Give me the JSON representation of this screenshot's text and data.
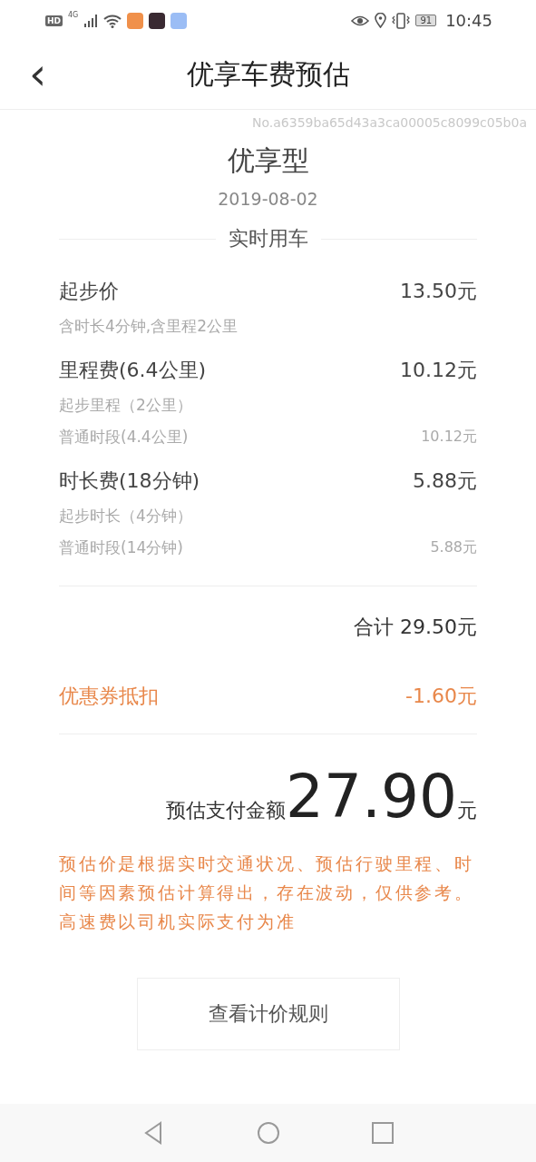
{
  "status_bar": {
    "hd": "HD",
    "network": "4G",
    "battery": "91",
    "time": "10:45"
  },
  "header": {
    "back": "‹",
    "title": "优享车费预估"
  },
  "order_no": "No.a6359ba65d43a3ca00005c8099c05b0a",
  "car_type": "优享型",
  "date": "2019-08-02",
  "section": "实时用车",
  "fees": [
    {
      "name": "起步价",
      "amount": "13.50元",
      "details": [
        {
          "label": "含时长4分钟,含里程2公里"
        }
      ]
    },
    {
      "name": "里程费(6.4公里)",
      "amount": "10.12元",
      "details": [
        {
          "label": "起步里程（2公里）"
        },
        {
          "label": "普通时段(4.4公里)",
          "amount": "10.12元"
        }
      ]
    },
    {
      "name": "时长费(18分钟)",
      "amount": "5.88元",
      "details": [
        {
          "label": "起步时长（4分钟）"
        },
        {
          "label": "普通时段(14分钟)",
          "amount": "5.88元"
        }
      ]
    }
  ],
  "total": "合计 29.50元",
  "coupon": {
    "label": "优惠券抵扣",
    "amount": "-1.60元"
  },
  "pay": {
    "label": "预估支付金额",
    "amount": "27.90",
    "unit": "元"
  },
  "note": "预估价是根据实时交通状况、预估行驶里程、时间等因素预估计算得出，存在波动，仅供参考。高速费以司机实际支付为准",
  "rules_button": "查看计价规则"
}
